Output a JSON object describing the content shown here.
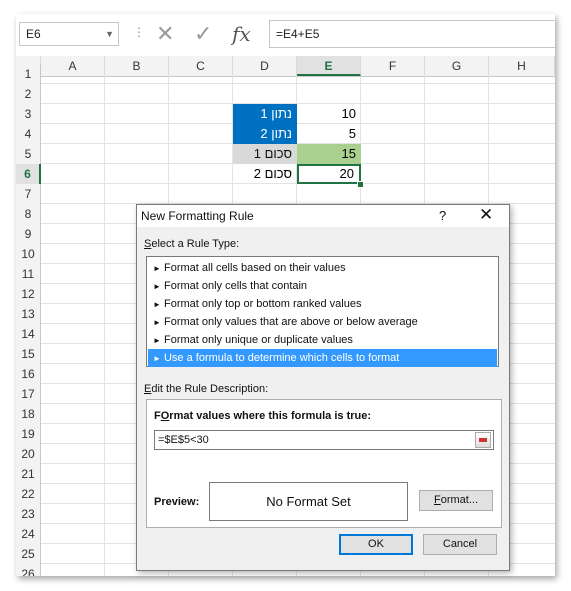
{
  "formula_bar": {
    "name_box": "E6",
    "formula": "=E4+E5",
    "dots": "⋮",
    "cancel_glyph": "✕",
    "enter_glyph": "✓",
    "fx_glyph": "fx"
  },
  "columns": [
    "A",
    "B",
    "C",
    "D",
    "E",
    "F",
    "G",
    "H"
  ],
  "rows": [
    "1",
    "2",
    "3",
    "4",
    "5",
    "6",
    "7",
    "8",
    "9",
    "10",
    "11",
    "12",
    "13",
    "14",
    "15",
    "16",
    "17",
    "18",
    "19",
    "20",
    "21",
    "22",
    "23",
    "24",
    "25",
    "26"
  ],
  "cells": {
    "d3": "נתון 1",
    "e3": "10",
    "d4": "נתון 2",
    "e4": "5",
    "d5": "סכום 1",
    "e5": "15",
    "d6": "סכום 2",
    "e6": "20"
  },
  "colors": {
    "accent": "#217346",
    "blue_fill": "#0070c0",
    "gray_fill": "#d9d9d9",
    "green_fill": "#a9d08e",
    "selection": "#3399ff"
  },
  "dialog": {
    "title": "New Formatting Rule",
    "help": "?",
    "close": "✕",
    "select_type_label_u": "S",
    "select_type_label": "elect a Rule Type:",
    "rule_types": [
      "Format all cells based on their values",
      "Format only cells that contain",
      "Format only top or bottom ranked values",
      "Format only values that are above or below average",
      "Format only unique or duplicate values",
      "Use a formula to determine which cells to format"
    ],
    "rule_arrow": "►",
    "edit_label_u": "E",
    "edit_label": "dit the Rule Description:",
    "formula_label_u": "O",
    "formula_label_pre": "F",
    "formula_label": "rmat values where this formula is true:",
    "formula_value": "=$E$5<30",
    "preview_label": "Preview:",
    "preview_text": "No Format Set",
    "format_button_u": "F",
    "format_button": "ormat...",
    "ok_button": "OK",
    "cancel_button": "Cancel"
  }
}
